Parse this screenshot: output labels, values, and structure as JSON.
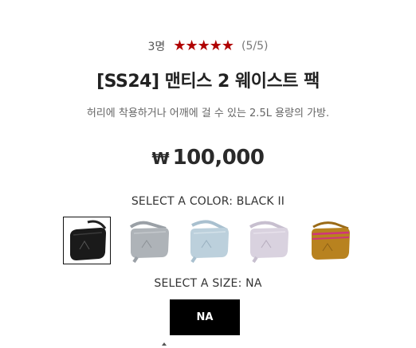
{
  "rating": {
    "count": "3명",
    "stars_filled": 5,
    "stars_total": 5,
    "score": "(5/5)",
    "star_color": "#b00000"
  },
  "product": {
    "title": "[SS24] 맨티스 2 웨이스트 팩",
    "description": "허리에 착용하거나 어깨에 걸 수 있는 2.5L 용량의 가방.",
    "currency_symbol": "₩",
    "price": "100,000"
  },
  "color_option": {
    "label": "SELECT A COLOR: BLACK II",
    "selected_index": 0,
    "swatches": [
      {
        "name": "black",
        "color": "#1a1a1a"
      },
      {
        "name": "light-grey",
        "color": "#aeb3b8"
      },
      {
        "name": "light-blue",
        "color": "#bcd0dc"
      },
      {
        "name": "lavender",
        "color": "#d9d2df"
      },
      {
        "name": "yellow-ochre",
        "color": "#b8821f"
      }
    ]
  },
  "size_option": {
    "label": "SELECT A SIZE: NA",
    "selected": "NA"
  }
}
